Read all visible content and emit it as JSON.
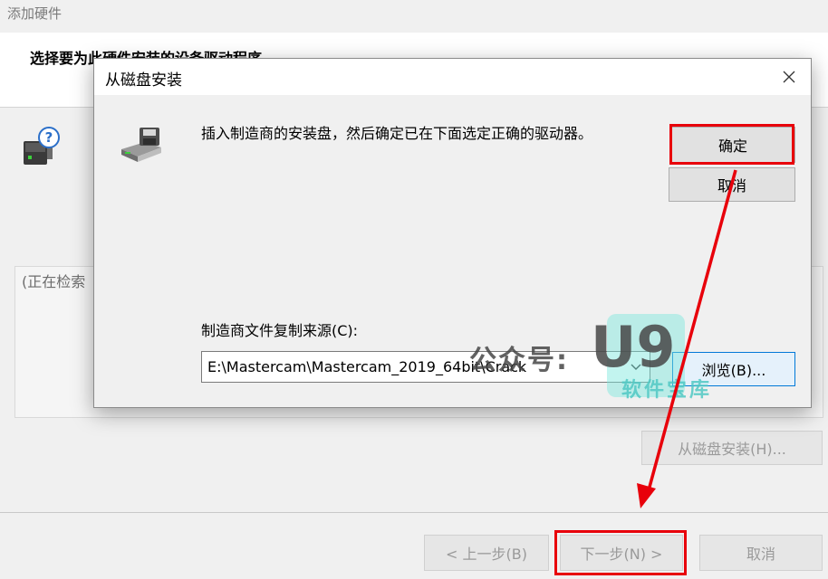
{
  "wizard": {
    "title": "添加硬件",
    "heading": "选择要为此硬件安装的设备驱动程序",
    "device_text": "",
    "list_status": "(正在检索",
    "have_disk_button": "从磁盘安装(H)...",
    "back_button": "< 上一步(B)",
    "next_button": "下一步(N) >",
    "cancel_button": "取消"
  },
  "dialog": {
    "title": "从磁盘安装",
    "close_icon": "close-icon",
    "message": "插入制造商的安装盘，然后确定已在下面选定正确的驱动器。",
    "ok_button": "确定",
    "cancel_button": "取消",
    "source_label": "制造商文件复制来源(C):",
    "source_value": "E:\\Mastercam\\Mastercam_2019_64bit\\Crack",
    "browse_button": "浏览(B)..."
  },
  "watermark": {
    "prefix": "公众号:",
    "brand": "U9",
    "sub": "软件宝库"
  },
  "colors": {
    "annotation_red": "#e8000b",
    "button_bg": "#e1e1e1",
    "window_bg": "#f0f0f0"
  },
  "icons": [
    "device-help-icon",
    "floppy-disk-icon",
    "close-icon",
    "chevron-down-icon"
  ]
}
